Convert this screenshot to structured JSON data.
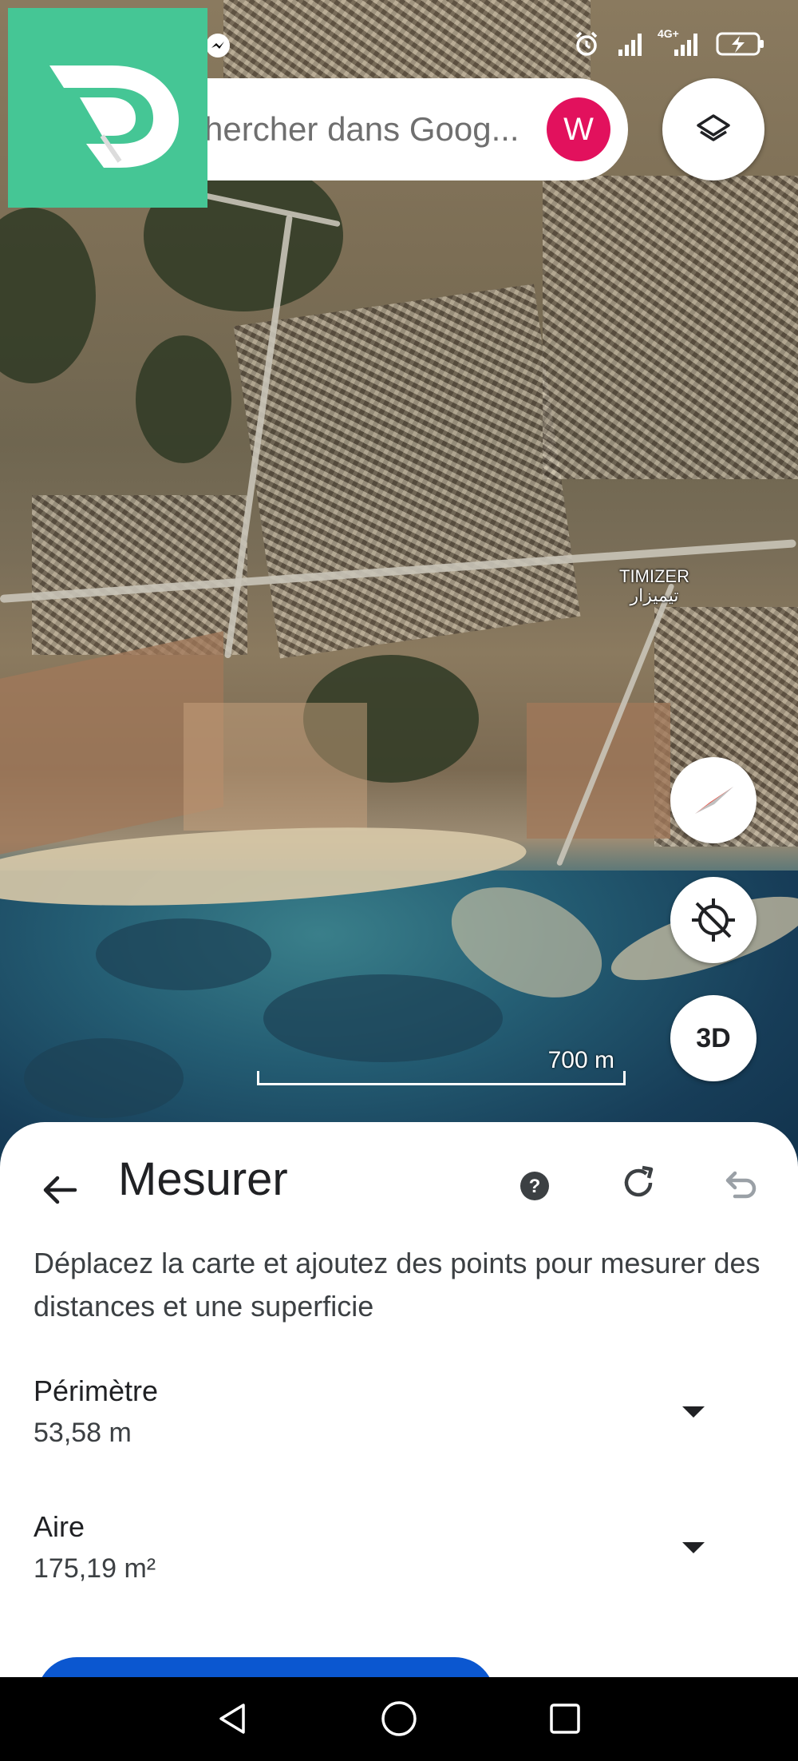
{
  "status_bar": {
    "icons": [
      "messenger-icon",
      "alarm-icon",
      "signal-icon",
      "4g-signal-icon",
      "battery-charging-icon"
    ],
    "network": "4G+"
  },
  "search": {
    "placeholder": "hercher dans Goog...",
    "avatar_letter": "W"
  },
  "map": {
    "place_label_latin": "TIMIZER",
    "place_label_arabic": "تيميزار",
    "scale_label": "700 m",
    "buttons": {
      "three_d": "3D"
    }
  },
  "measure_sheet": {
    "title": "Mesurer",
    "description": "Déplacez la carte et ajoutez des points pour mesurer des distances et une superficie",
    "perimeter": {
      "label": "Périmètre",
      "value": "53,58 m"
    },
    "area": {
      "label": "Aire",
      "value": "175,19 m²"
    }
  },
  "colors": {
    "brand_logo": "#45c695",
    "avatar": "#e2115d",
    "primary_button": "#0b57d0",
    "compass_needle": "#e8473a"
  }
}
